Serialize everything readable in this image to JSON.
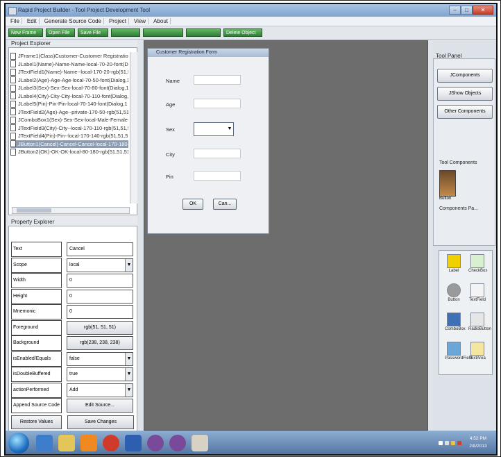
{
  "window": {
    "title": "Rapid Project Builder - Tool Project Development Tool",
    "controls": [
      "–",
      "□",
      "✕"
    ]
  },
  "menu": [
    "File",
    "Edit",
    "Generate Source Code",
    "Project",
    "View",
    "About"
  ],
  "toolbar": [
    "New Frame",
    "Open File",
    "Save File",
    "",
    "",
    "",
    "Delete Object"
  ],
  "project_explorer": {
    "title": "Project Explorer",
    "files": [
      "JFrame1(Class)Customer-Customer Registration Form-...",
      "JLabel1(Name)-Name-Name-local-70-20-font(Dialog,1",
      "JTextField1(Name)-Name--local-170-20-rgb(51,51,51)",
      "JLabel2(Age)-Age-Age-local-70-50-font(Dialog,1",
      "JLabel3(Sex)-Sex-Sex-local-70-80-font(Dialog,1",
      "JLabel4(City)-City-City-local-70-110-font(Dialog,1",
      "JLabel5(Pin)-Pin-Pin-local-70-140-font(Dialog,1",
      "JTextField2(Age)-Age--private-170-50-rgb(51,51,51)",
      "JComboBox1(Sex)-Sex-Sex-local-Male-Female-170-80",
      "JTextField3(City)-City--local-170-110-rgb(51,51,51)",
      "JTextField4(Pin)-Pin--local-170-140-rgb(51,51,51)",
      "JButton1(Cancel)-Cancel-Cancel-local-170-180-rgb(",
      "JButton2(OK)-OK-OK-local-80-180-rgb(51,51,51)"
    ],
    "selected_index": 11
  },
  "property_explorer": {
    "title": "Property Explorer",
    "rows": [
      {
        "key": "Text",
        "value": "Cancel",
        "type": "text"
      },
      {
        "key": "Scope",
        "value": "local",
        "type": "select"
      },
      {
        "key": "Width",
        "value": "0",
        "type": "text"
      },
      {
        "key": "Height",
        "value": "0",
        "type": "text"
      },
      {
        "key": "Mnemonic",
        "value": "0",
        "type": "text"
      },
      {
        "key": "Foreground",
        "value": "rgb(51, 51, 51)",
        "type": "button"
      },
      {
        "key": "Background",
        "value": "rgb(238, 238, 238)",
        "type": "button"
      },
      {
        "key": "isEnabled/Equals",
        "value": "false",
        "type": "select"
      },
      {
        "key": "isDoubleBuffered",
        "value": "true",
        "type": "select"
      },
      {
        "key": "actionPerformed",
        "value": "Add",
        "type": "select"
      },
      {
        "key": "Append Source Code",
        "value": "Edit Source...",
        "type": "button"
      }
    ],
    "restore_label": "Restore Values",
    "save_label": "Save Changes"
  },
  "form": {
    "title": "Customer Registration Form",
    "labels": {
      "name": "Name",
      "age": "Age",
      "sex": "Sex",
      "city": "City",
      "pin": "Pin"
    },
    "ok_label": "OK",
    "cancel_label": "Can..."
  },
  "tool_panel": {
    "title": "Tool Panel",
    "buttons": [
      "JComponents",
      "JShow Objects",
      "Other Components"
    ],
    "tool_components_title": "Tool Components",
    "tool_component_label": "Button",
    "palette_title": "Components Pa...",
    "palette": [
      "Label",
      "CheckBox",
      "Button",
      "TextField",
      "ComboBox",
      "RadioButton",
      "PasswordField",
      "TextArea"
    ]
  },
  "taskbar": {
    "clock_time": "4:52 PM",
    "clock_date": "2/8/2013"
  },
  "colors": {
    "workspace": "#6d6d6d",
    "toolbar_button": "#3e8d44",
    "selected_row": "#8d9bb0",
    "taskbar": "#4c6f9d"
  }
}
